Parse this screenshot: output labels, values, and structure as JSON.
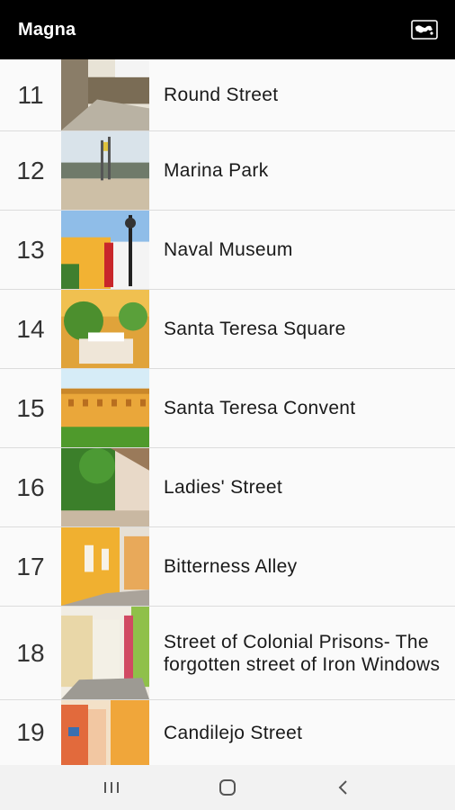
{
  "app": {
    "title": "Magna"
  },
  "header": {
    "map_icon": "map-icon"
  },
  "items": [
    {
      "number": "11",
      "title": "Round Street"
    },
    {
      "number": "12",
      "title": "Marina Park"
    },
    {
      "number": "13",
      "title": "Naval Museum"
    },
    {
      "number": "14",
      "title": "Santa Teresa Square"
    },
    {
      "number": "15",
      "title": "Santa Teresa Convent"
    },
    {
      "number": "16",
      "title": "Ladies' Street"
    },
    {
      "number": "17",
      "title": "Bitterness Alley"
    },
    {
      "number": "18",
      "title": "Street of Colonial Prisons- The forgotten street of Iron Windows"
    },
    {
      "number": "19",
      "title": "Candilejo Street"
    }
  ],
  "navbar": {
    "icons": [
      "recent-apps-icon",
      "home-icon",
      "back-icon"
    ]
  },
  "colors": {
    "appbar": "#000000",
    "row_bg": "#fafafa",
    "divider": "#dcdcdc",
    "navbar": "#f2f2f2"
  }
}
